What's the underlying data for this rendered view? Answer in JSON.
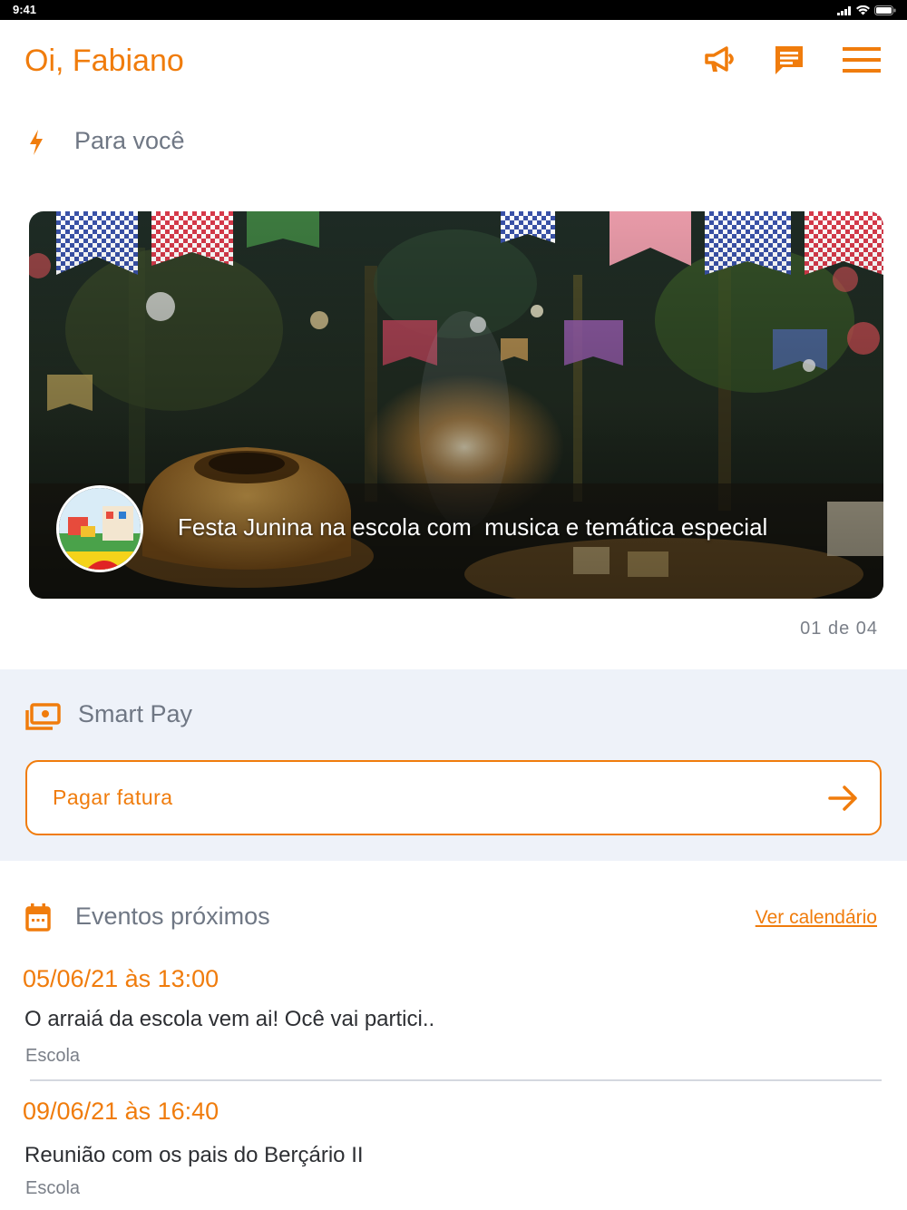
{
  "status_bar": {
    "time": "9:41"
  },
  "header": {
    "greeting": "Oi, Fabiano",
    "icons": [
      "megaphone-icon",
      "chat-icon",
      "menu-icon"
    ]
  },
  "for_you": {
    "title": "Para você",
    "icon": "lightning-icon",
    "carousel": {
      "caption": "Festa Junina na escola com  musica e temática especial",
      "counter": "01 de 04"
    }
  },
  "smart_pay": {
    "title": "Smart Pay",
    "icon": "money-icon",
    "button_label": "Pagar fatura"
  },
  "events": {
    "title": "Eventos próximos",
    "icon": "calendar-icon",
    "link": "Ver calendário",
    "items": [
      {
        "date": "05/06/21 às 13:00",
        "title": "O arraiá da escola vem ai! Ocê vai partici..",
        "source": "Escola"
      },
      {
        "date": "09/06/21 às 16:40",
        "title": "Reunião com os pais do Berçário II",
        "source": "Escola"
      }
    ]
  },
  "colors": {
    "accent": "#f07c0c",
    "muted": "#6f7784",
    "section_bg": "#eef2f9"
  }
}
